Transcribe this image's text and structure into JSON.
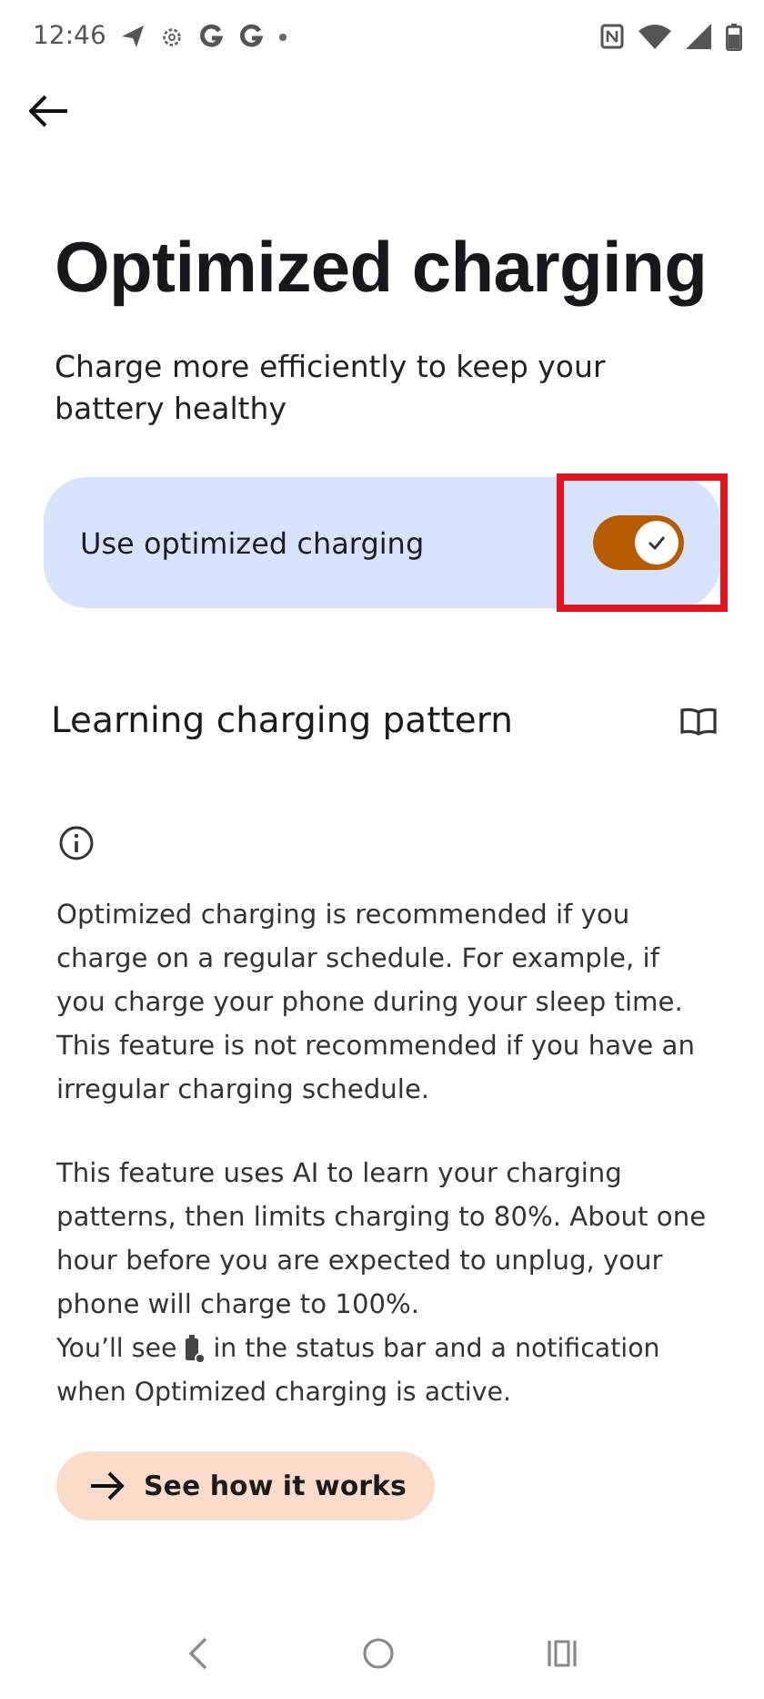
{
  "status_bar": {
    "time": "12:46"
  },
  "title": "Optimized charging",
  "subtitle": "Charge more efficiently to keep your battery healthy",
  "toggle": {
    "label": "Use optimized charging",
    "on": true,
    "highlighted": true
  },
  "section": {
    "title": "Learning charging pattern"
  },
  "paragraphs": [
    "Optimized charging is recommended if you charge on a regular schedule. For example, if you charge your phone during your sleep time. This feature is not recommended if you have an irregular charging schedule.",
    "This feature uses AI to learn your charging patterns, then limits charging to 80%. About one hour before you are expected to unplug, your phone will charge to 100%."
  ],
  "note": {
    "before": "You’ll see",
    "after": "in the status bar and a notification",
    "continuation": "when Optimized charging is active."
  },
  "button": {
    "label": "See how it works"
  }
}
